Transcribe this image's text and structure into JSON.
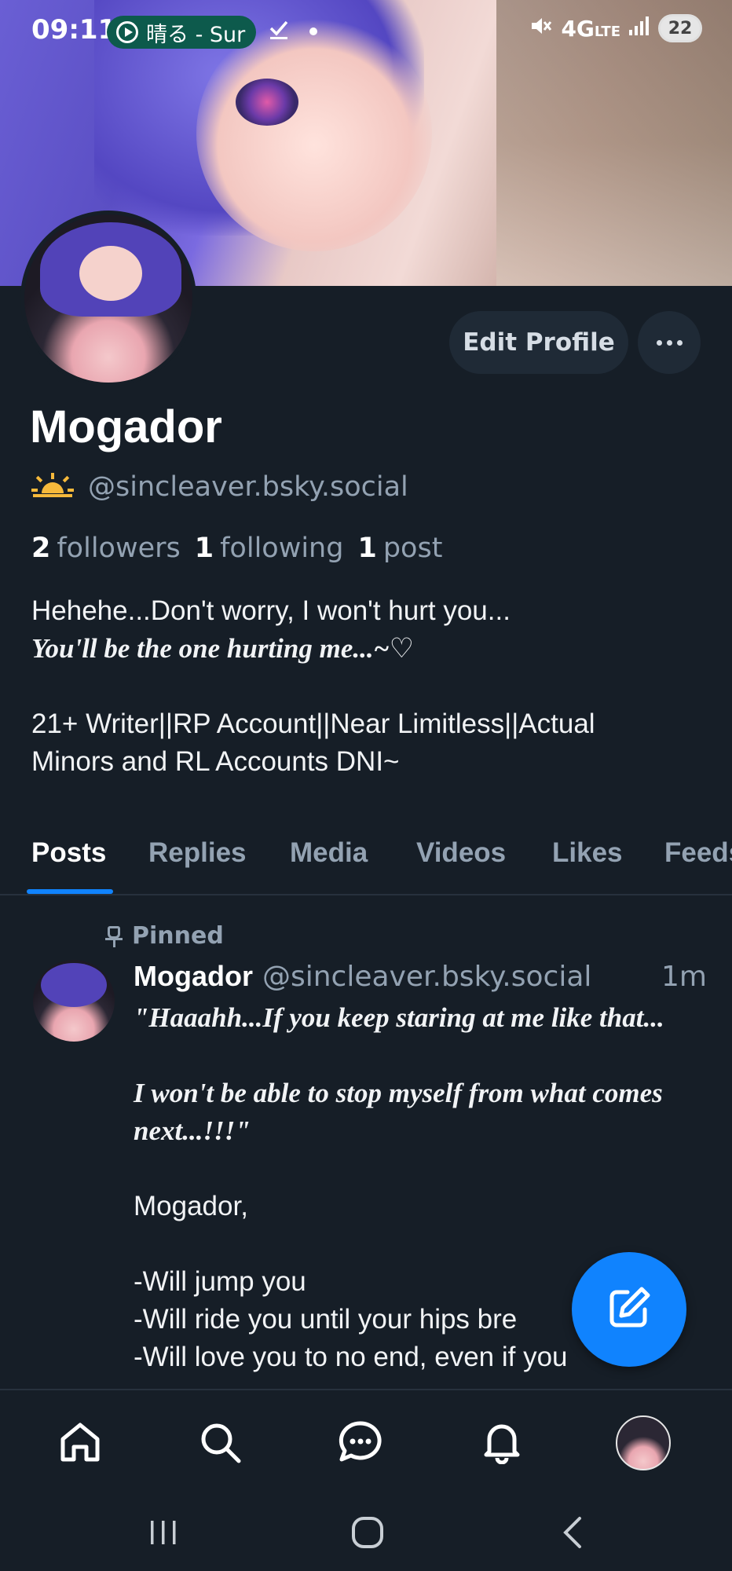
{
  "status_bar": {
    "time": "09:11",
    "media_text": "晴る - Sur",
    "network": "4G",
    "network_sub": "LTE",
    "battery": "22"
  },
  "profile": {
    "edit_button": "Edit Profile",
    "display_name": "Mogador",
    "handle": "@sincleaver.bsky.social",
    "stats": {
      "followers_count": "2",
      "followers_label": "followers",
      "following_count": "1",
      "following_label": "following",
      "posts_count": "1",
      "posts_label": "post"
    },
    "bio_line1": "Hehehe...Don't worry, I won't hurt you...",
    "bio_line2": "You'll be the one hurting me...~♡",
    "bio_line3": "21+ Writer||RP Account||Near Limitless||Actual",
    "bio_line4": "Minors and RL Accounts DNI~"
  },
  "tabs": [
    "Posts",
    "Replies",
    "Media",
    "Videos",
    "Likes",
    "Feeds"
  ],
  "post": {
    "pinned_label": "Pinned",
    "author": "Mogador",
    "handle": "@sincleaver.bsky.social",
    "time": "1m",
    "line1": "\"Haaahh...If you keep staring at me like that...",
    "line2": "I won't be able to stop myself from what comes",
    "line3": "next...!!!\"",
    "line4": "Mogador,",
    "line5": "-Will jump you",
    "line6": "-Will ride you until your hips bre",
    "line7": "-Will love you to no end, even if you"
  },
  "colors": {
    "background": "#161e27",
    "accent": "#1083fe",
    "muted_text": "#93a2b2"
  }
}
